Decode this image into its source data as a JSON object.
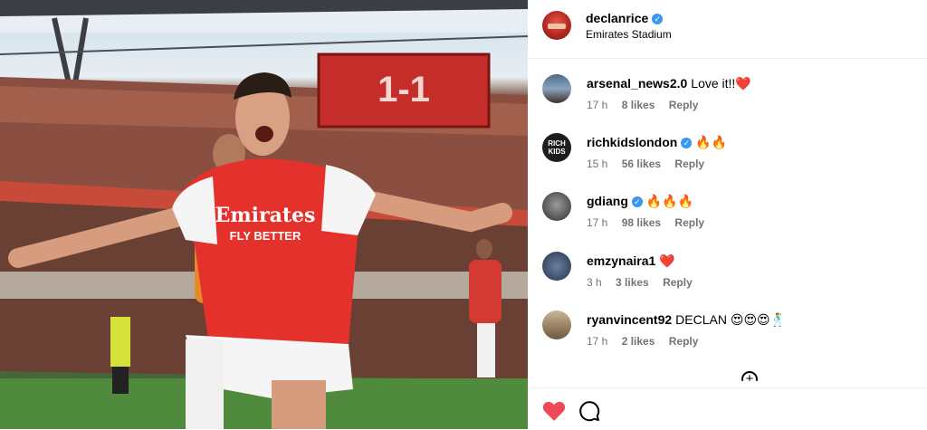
{
  "post": {
    "username": "declanrice",
    "verified": true,
    "location": "Emirates Stadium"
  },
  "photo": {
    "scoreboard": "1-1",
    "shirt_sponsor_line1": "Emirates",
    "shirt_sponsor_line2": "FLY BETTER"
  },
  "comments": [
    {
      "username": "arsenal_news2.0",
      "verified": false,
      "text": "Love it!!❤️",
      "time": "17 h",
      "likes": "8 likes",
      "reply": "Reply"
    },
    {
      "username": "richkidslondon",
      "verified": true,
      "text": "🔥🔥",
      "time": "15 h",
      "likes": "56 likes",
      "reply": "Reply",
      "avatar_text": "RICH KIDS"
    },
    {
      "username": "gdiang",
      "verified": true,
      "text": "🔥🔥🔥",
      "time": "17 h",
      "likes": "98 likes",
      "reply": "Reply"
    },
    {
      "username": "emzynaira1",
      "verified": false,
      "text": "❤️",
      "time": "3 h",
      "likes": "3 likes",
      "reply": "Reply"
    },
    {
      "username": "ryanvincent92",
      "verified": false,
      "text": "DECLAN 😍😍😍🕺",
      "time": "17 h",
      "likes": "2 likes",
      "reply": "Reply"
    }
  ],
  "colors": {
    "verified": "#3897f0",
    "like": "#ed4956",
    "meta": "#737373"
  },
  "icons": {
    "like": "heart-filled-icon",
    "comment": "comment-bubble-icon",
    "more": "plus-circle-icon"
  }
}
